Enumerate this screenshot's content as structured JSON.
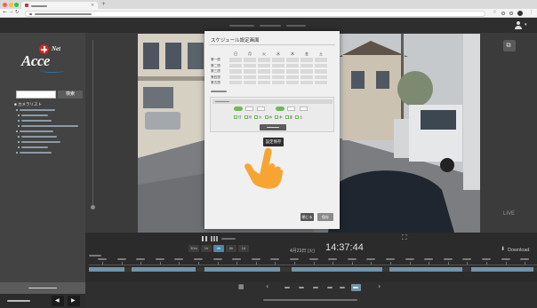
{
  "header": {
    "user_icon": "user-icon"
  },
  "sidebar": {
    "logo": {
      "main": "Acce",
      "sup": "Net",
      "icon": "red-cross-circle-icon"
    },
    "search": {
      "button": "検索"
    },
    "tree": {
      "root": "■ カメラリスト"
    }
  },
  "modal": {
    "title": "スケジュール設定画面",
    "days": [
      "日",
      "月",
      "火",
      "水",
      "木",
      "金",
      "土"
    ],
    "weeks": [
      "第一週",
      "第二週",
      "第三週",
      "第四週",
      "第五週"
    ],
    "save_settings": "設定保存",
    "close": "閉じる",
    "save": "保存",
    "cursor_icon": "pointing-hand-icon"
  },
  "video": {
    "live_label": "LIVE"
  },
  "playback": {
    "scales": [
      "30m",
      "1h",
      "4h",
      "8h",
      "1d"
    ],
    "active_scale": 2,
    "date": "4月23日 (火)",
    "time": "14:37:44",
    "download": "Download"
  },
  "colors": {
    "accent_green": "#6dbb55",
    "active_blue": "#4d87ab",
    "cursor_orange": "#f6a533",
    "brand_red": "#d8261f"
  }
}
